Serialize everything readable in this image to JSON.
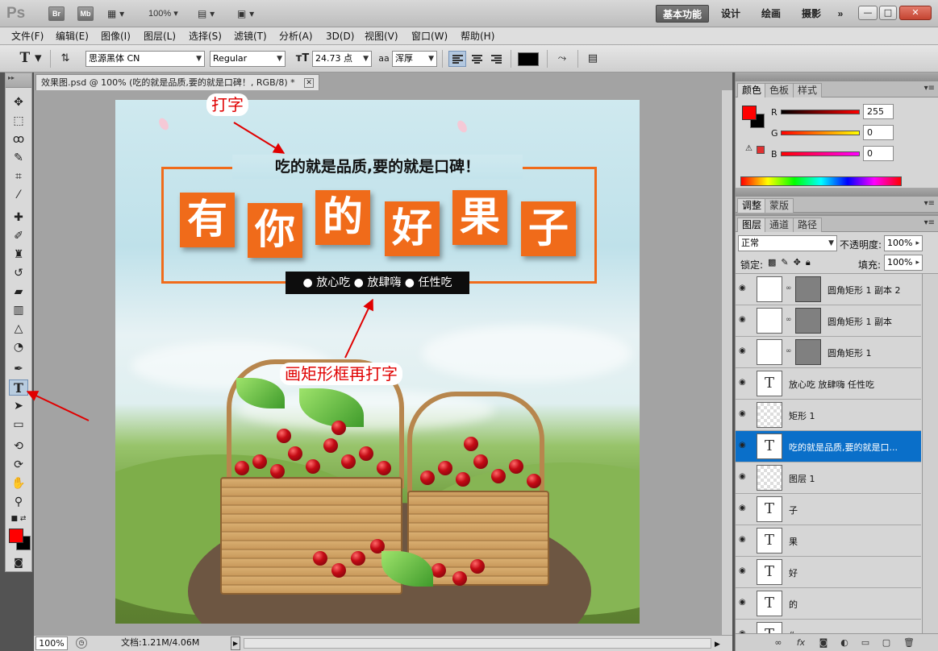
{
  "app": {
    "logo": "Ps",
    "bridge_btn": "Br",
    "minibridge_btn": "Mb",
    "zoom": "100%",
    "workspaces": [
      "基本功能",
      "设计",
      "绘画",
      "摄影"
    ],
    "more": "»",
    "window_controls": [
      "—",
      "□",
      "✕"
    ]
  },
  "menu": [
    "文件(F)",
    "编辑(E)",
    "图像(I)",
    "图层(L)",
    "选择(S)",
    "滤镜(T)",
    "分析(A)",
    "3D(D)",
    "视图(V)",
    "窗口(W)",
    "帮助(H)"
  ],
  "options": {
    "font_family": "思源黑体 CN",
    "font_style": "Regular",
    "font_size": "24.73 点",
    "aa_label": "aa",
    "antialias": "浑厚",
    "text_color": "#000000"
  },
  "document": {
    "tab_title": "效果图.psd @ 100% (吃的就是品质,要的就是口碑！, RGB/8) *",
    "close": "✕"
  },
  "canvas": {
    "top_slogan": "吃的就是品质,要的就是口碑！",
    "big_chars": [
      "有",
      "你",
      "的",
      "好",
      "果",
      "子"
    ],
    "sub_slogan": "● 放心吃 ● 放肆嗨 ● 任性吃",
    "accent": "#f06b1a"
  },
  "annotations": {
    "type_text": "打字",
    "rect_then_type": "画矩形框再打字"
  },
  "status": {
    "zoom": "100%",
    "doc_info": "文档:1.21M/4.06M"
  },
  "color_panel": {
    "tabs": [
      "颜色",
      "色板",
      "样式"
    ],
    "channels": [
      {
        "label": "R",
        "value": "255"
      },
      {
        "label": "G",
        "value": "0"
      },
      {
        "label": "B",
        "value": "0"
      }
    ],
    "foreground": "#ff0000",
    "background": "#000000"
  },
  "adjust_panel": {
    "tabs": [
      "调整",
      "蒙版"
    ]
  },
  "layers_panel": {
    "tabs": [
      "图层",
      "通道",
      "路径"
    ],
    "blend_mode": "正常",
    "opacity_label": "不透明度:",
    "opacity": "100%",
    "lock_label": "锁定:",
    "fill_label": "填充:",
    "fill": "100%",
    "layers": [
      {
        "name": "圆角矩形 1 副本 2",
        "kind": "shape"
      },
      {
        "name": "圆角矩形 1 副本",
        "kind": "shape"
      },
      {
        "name": "圆角矩形 1",
        "kind": "shape"
      },
      {
        "name": "放心吃   放肆嗨   任性吃",
        "kind": "text"
      },
      {
        "name": "矩形 1",
        "kind": "raster"
      },
      {
        "name": "吃的就是品质,要的就是口...",
        "kind": "text",
        "selected": true
      },
      {
        "name": "图层 1",
        "kind": "raster"
      },
      {
        "name": "子",
        "kind": "text"
      },
      {
        "name": "果",
        "kind": "text"
      },
      {
        "name": "好",
        "kind": "text"
      },
      {
        "name": "的",
        "kind": "text"
      },
      {
        "name": "你",
        "kind": "text"
      }
    ]
  }
}
